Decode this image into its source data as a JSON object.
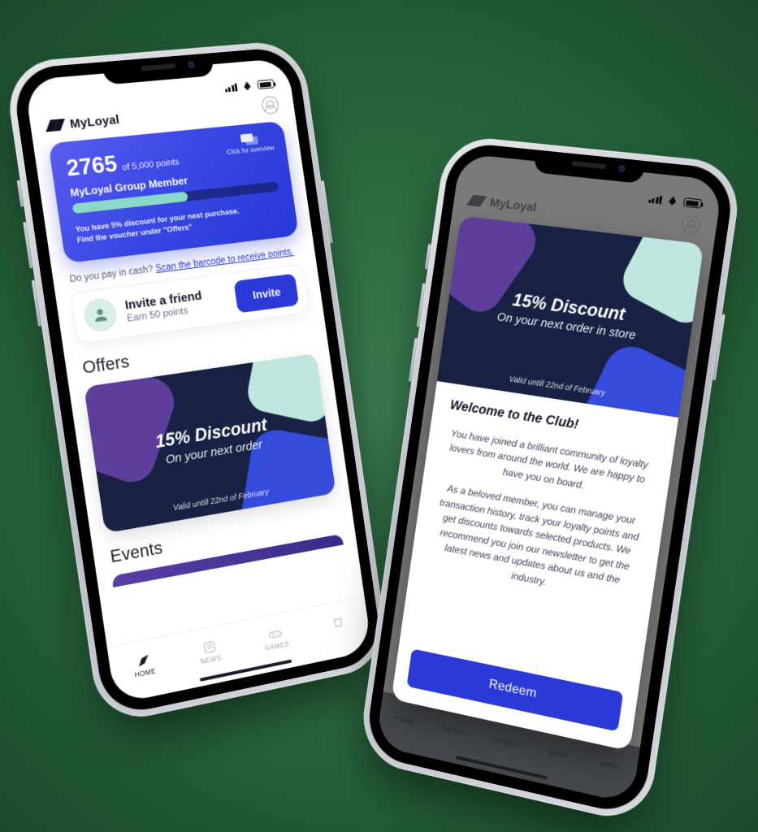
{
  "brand": "MyLoyal",
  "phone1": {
    "points": {
      "value": "2765",
      "cap": "of 5,000 points",
      "tier": "MyLoyal Group Member",
      "progress_pct": 55
    },
    "overview_label": "Click for overview",
    "discount_note_l1": "You have 5% discount for your next purchase.",
    "discount_note_l2": "Find the voucher under \"Offers\"",
    "cash_prefix": "Do you pay in cash? ",
    "cash_link": "Scan the barcode to receive points.",
    "invite": {
      "title": "Invite a friend",
      "sub": "Earn 50 points",
      "btn": "Invite"
    },
    "offers_heading": "Offers",
    "offer": {
      "big": "15% Discount",
      "sub": "On your next order",
      "valid": "Valid untill 22nd of February"
    },
    "events_heading": "Events",
    "tabs": {
      "home": "HOME",
      "news": "NEWS",
      "games": "GAMES"
    }
  },
  "phone2": {
    "hero": {
      "big": "15% Discount",
      "sub": "On your next order in store",
      "valid": "Valid untill 22nd of February"
    },
    "welcome_h": "Welcome to the Club!",
    "p1": "You have joined a brilliant community of loyalty lovers from around the world. We are happy to have you on board.",
    "p2": "As a beloved member, you can manage your transaction history, track your loyalty points and get discounts towards selected products. We recommend you join our newsletter to get the latest news and updates about us and the industry.",
    "redeem": "Redeem",
    "tabs": {
      "home": "HOME",
      "news": "NEWS",
      "games": "GAMES",
      "shop": "SHOP",
      "more": "MORE"
    }
  }
}
